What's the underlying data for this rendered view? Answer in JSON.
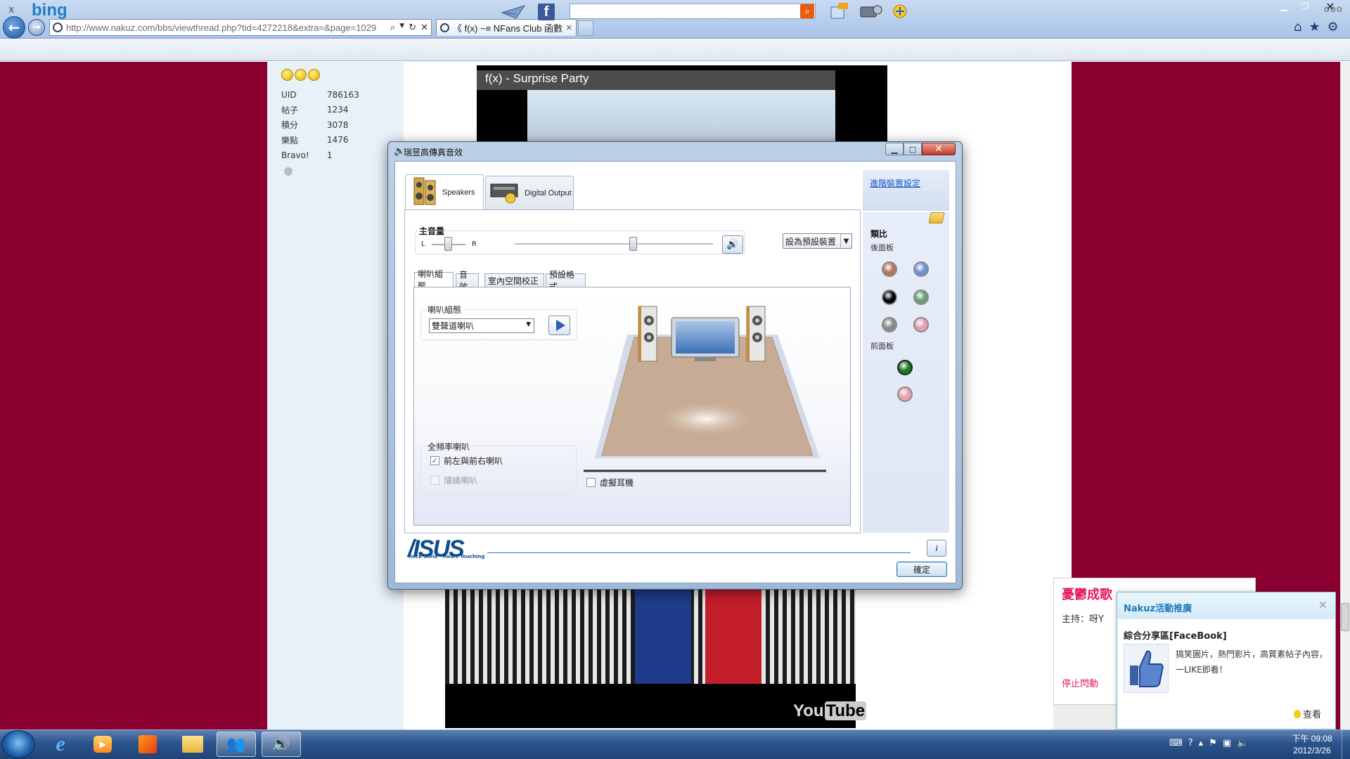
{
  "browser": {
    "url": "http://www.nakuz.com/bbs/viewthread.php?tid=4272218&extra=&page=1029",
    "tab_title": "《 f(x) ~≡ NFans Club 函數...",
    "tab_close": "✕",
    "close_glyph": "✕",
    "min_glyph": "▁",
    "max_glyph": "❐"
  },
  "toolbar": {
    "close_glyph": "x",
    "logo": "bing",
    "fb": "f",
    "more": "ooo"
  },
  "profile": {
    "stats": [
      {
        "key": "UID",
        "value": "786163"
      },
      {
        "key": "帖子",
        "value": "1234"
      },
      {
        "key": "積分",
        "value": "3078"
      },
      {
        "key": "樂點",
        "value": "1476"
      },
      {
        "key": "Bravo!",
        "value": "1"
      }
    ]
  },
  "video": {
    "title": "f(x) - Surprise Party",
    "brand_you": "You",
    "brand_tube": "Tube"
  },
  "side_widget": {
    "title": "憂鬱成歌",
    "host": "主持：呀Y",
    "stop": "停止閃動"
  },
  "popup": {
    "title": "Nakuz活動推廣",
    "subtitle": "綜合分享區[FaceBook]",
    "description": "搞笑圖片，熱門影片，高質素帖子內容，一LIKE即看！",
    "view": "查看",
    "close": "✕"
  },
  "dialog": {
    "title": "瑞昱高傳真音效",
    "advanced_link": "進階裝置設定",
    "device_tabs": [
      {
        "label": "Speakers",
        "active": true
      },
      {
        "label": "Digital Output",
        "active": false
      }
    ],
    "main_volume": {
      "label": "主音量",
      "left": "L",
      "right": "R",
      "balance": 0.5,
      "level": 0.6
    },
    "default_device": "設為預設裝置",
    "inner_tabs": [
      {
        "label": "喇叭組態"
      },
      {
        "label": "音效"
      },
      {
        "label": "室內空間校正"
      },
      {
        "label": "預設格式"
      }
    ],
    "config_group_label": "喇叭組態",
    "config_value": "雙聲道喇叭",
    "fullrange_label": "全頻率喇叭",
    "checkboxes": [
      {
        "label": "前左與前右喇叭",
        "checked": true,
        "enabled": true
      },
      {
        "label": "環繞喇叭",
        "checked": false,
        "enabled": false
      }
    ],
    "virtual_headphones": {
      "label": "虛擬耳機",
      "checked": false
    },
    "jack_panel": {
      "analog_label": "類比",
      "rear_label": "後面板",
      "front_label": "前面板",
      "rear_jacks": [
        "#b8745a",
        "#6f8fd8",
        "#000000",
        "#68a070",
        "#8a8a8a",
        "#e6a0b0"
      ],
      "front_jacks": [
        "#1a7a22",
        "#e6a0b0"
      ]
    },
    "asus_logo": "/ISUS",
    "asus_tagline": "Rock Solid · Heart Touching",
    "info": "i",
    "ok": "確定",
    "min": "▁",
    "max": "□",
    "close": "✕"
  },
  "taskbar": {
    "time": "下午 09:08",
    "date": "2012/3/26"
  },
  "colors": {
    "maroon": "#8b0030",
    "accent": "#1f7ab8"
  }
}
